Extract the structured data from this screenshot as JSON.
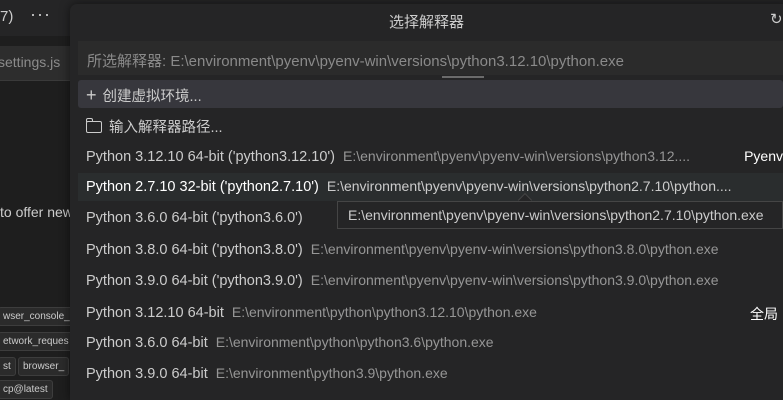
{
  "background": {
    "paren": "7)",
    "dots": "···",
    "tab_label": "settings.js",
    "text_line": "to offer new",
    "chips": [
      "wser_console_n",
      "etwork_reques",
      "st",
      "browser_",
      "cp@latest"
    ]
  },
  "quickpick": {
    "title": "选择解释器",
    "refresh_icon": "refresh-icon",
    "input_placeholder": "所选解释器: E:\\environment\\pyenv\\pyenv-win\\versions\\python3.12.10\\python.exe",
    "actions": [
      {
        "icon": "plus-icon",
        "label": "创建虚拟环境..."
      },
      {
        "icon": "folder-icon",
        "label": "输入解释器路径..."
      }
    ],
    "items": [
      {
        "label": "Python 3.12.10 64-bit ('python3.12.10')",
        "path": "E:\\environment\\pyenv\\pyenv-win\\versions\\python3.12....",
        "tag": "Pyenv"
      },
      {
        "label": "Python 2.7.10 32-bit ('python2.7.10')",
        "path": "E:\\environment\\pyenv\\pyenv-win\\versions\\python2.7.10\\python....",
        "tag": ""
      },
      {
        "label": "Python 3.6.0 64-bit ('python3.6.0')",
        "path": "",
        "tag": ""
      },
      {
        "label": "Python 3.8.0 64-bit ('python3.8.0')",
        "path": "E:\\environment\\pyenv\\pyenv-win\\versions\\python3.8.0\\python.exe",
        "tag": ""
      },
      {
        "label": "Python 3.9.0 64-bit ('python3.9.0')",
        "path": "E:\\environment\\pyenv\\pyenv-win\\versions\\python3.9.0\\python.exe",
        "tag": ""
      },
      {
        "label": "Python 3.12.10 64-bit",
        "path": "E:\\environment\\python\\python3.12.10\\python.exe",
        "tag": "全局"
      },
      {
        "label": "Python 3.6.0 64-bit",
        "path": "E:\\environment\\python\\python3.6\\python.exe",
        "tag": ""
      },
      {
        "label": "Python 3.9.0 64-bit",
        "path": "E:\\environment\\python3.9\\python.exe",
        "tag": ""
      }
    ],
    "tooltip": "E:\\environment\\pyenv\\pyenv-win\\versions\\python2.7.10\\python.exe"
  }
}
